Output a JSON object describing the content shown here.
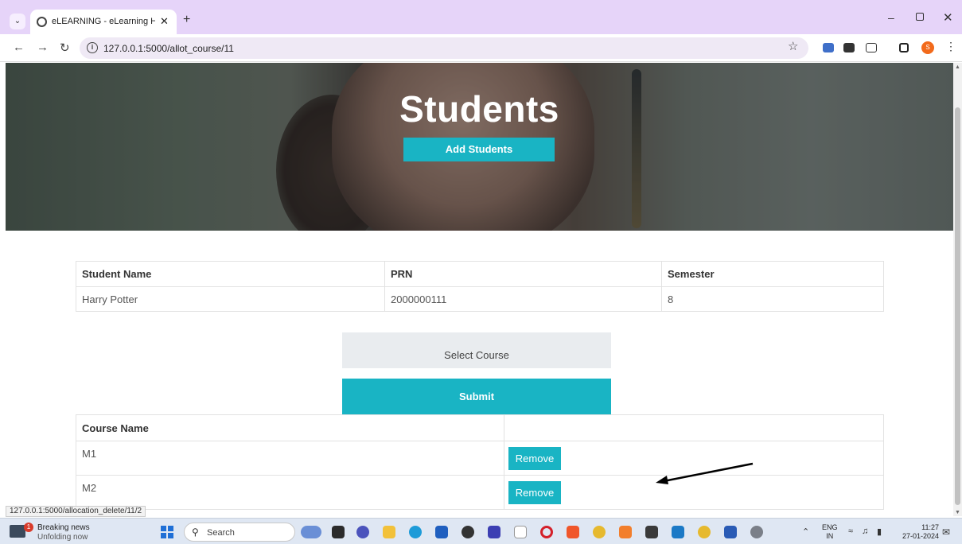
{
  "browser": {
    "tab_title": "eLEARNING - eLearning HTML",
    "url": "127.0.0.1:5000/allot_course/11",
    "status_url": "127.0.0.1:5000/allocation_delete/11/2"
  },
  "hero": {
    "title": "Students",
    "add_button": "Add Students"
  },
  "students_table": {
    "headers": [
      "Student Name",
      "PRN",
      "Semester"
    ],
    "rows": [
      [
        "Harry Potter",
        "2000000111",
        "8"
      ]
    ]
  },
  "course_form": {
    "select_label": "Select Course",
    "submit_label": "Submit"
  },
  "course_table": {
    "headers": [
      "Course Name",
      ""
    ],
    "rows": [
      {
        "name": "M1",
        "action": "Remove"
      },
      {
        "name": "M2",
        "action": "Remove"
      }
    ]
  },
  "taskbar": {
    "news_title": "Breaking news",
    "news_sub": "Unfolding now",
    "news_badge": "1",
    "search_label": "Search",
    "lang_1": "ENG",
    "lang_2": "IN",
    "time": "11:27",
    "date": "27-01-2024"
  },
  "colors": {
    "accent": "#19b4c4",
    "tabstrip": "#e6d4f9"
  }
}
